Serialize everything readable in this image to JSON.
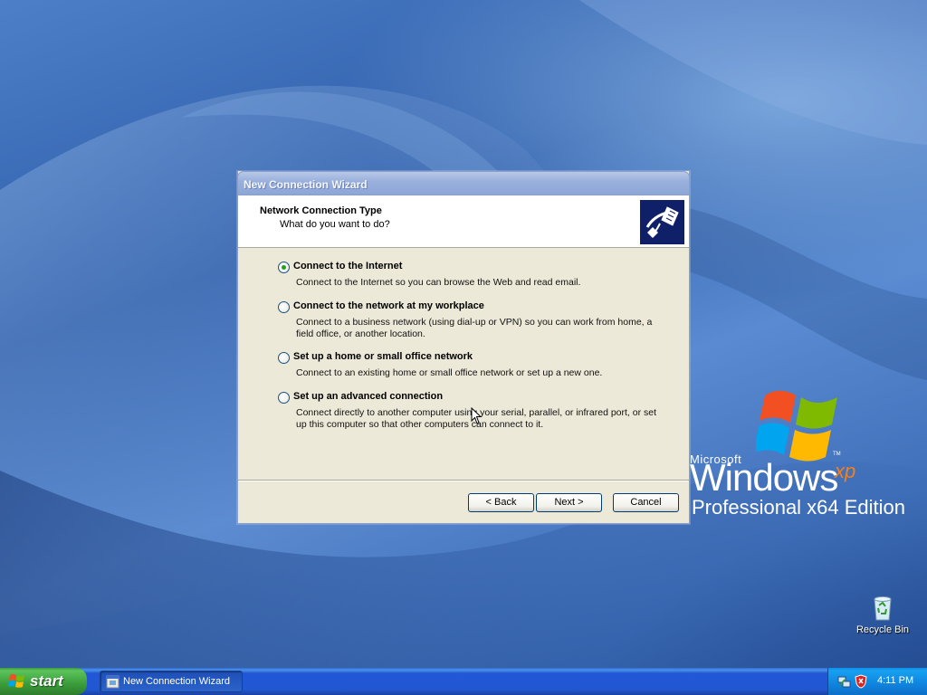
{
  "desktop": {
    "logo": {
      "microsoft": "Microsoft",
      "windows": "Windows",
      "xp": "xp",
      "tm": "TM",
      "edition": "Professional x64 Edition"
    },
    "icons": [
      {
        "label": "Recycle Bin",
        "icon": "recycle-bin-icon"
      }
    ]
  },
  "wizard": {
    "title": "New Connection Wizard",
    "header": {
      "title": "Network Connection Type",
      "subtitle": "What do you want to do?"
    },
    "options": [
      {
        "label": "Connect to the Internet",
        "description": "Connect to the Internet so you can browse the Web and read email.",
        "selected": true
      },
      {
        "label": "Connect to the network at my workplace",
        "description": "Connect to a business network (using dial-up or VPN) so you can work from home, a field office, or another location.",
        "selected": false
      },
      {
        "label": "Set up a home or small office network",
        "description": "Connect to an existing home or small office network or set up a new one.",
        "selected": false
      },
      {
        "label": "Set up an advanced connection",
        "description": "Connect directly to another computer using your serial, parallel, or infrared port, or set up this computer so that other computers can connect to it.",
        "selected": false
      }
    ],
    "buttons": {
      "back": "< Back",
      "next": "Next >",
      "cancel": "Cancel"
    }
  },
  "taskbar": {
    "start_label": "start",
    "tasks": [
      {
        "label": "New Connection Wizard",
        "active": true
      }
    ],
    "tray": {
      "icons": [
        "network-icon",
        "security-shield-icon"
      ],
      "clock": "4:11 PM"
    }
  },
  "colors": {
    "titlebar": "#9ab1dc",
    "dialog_bg": "#ece9d8",
    "taskbar": "#2257d2",
    "start_green": "#3a9c3a",
    "tray": "#0f84de"
  }
}
